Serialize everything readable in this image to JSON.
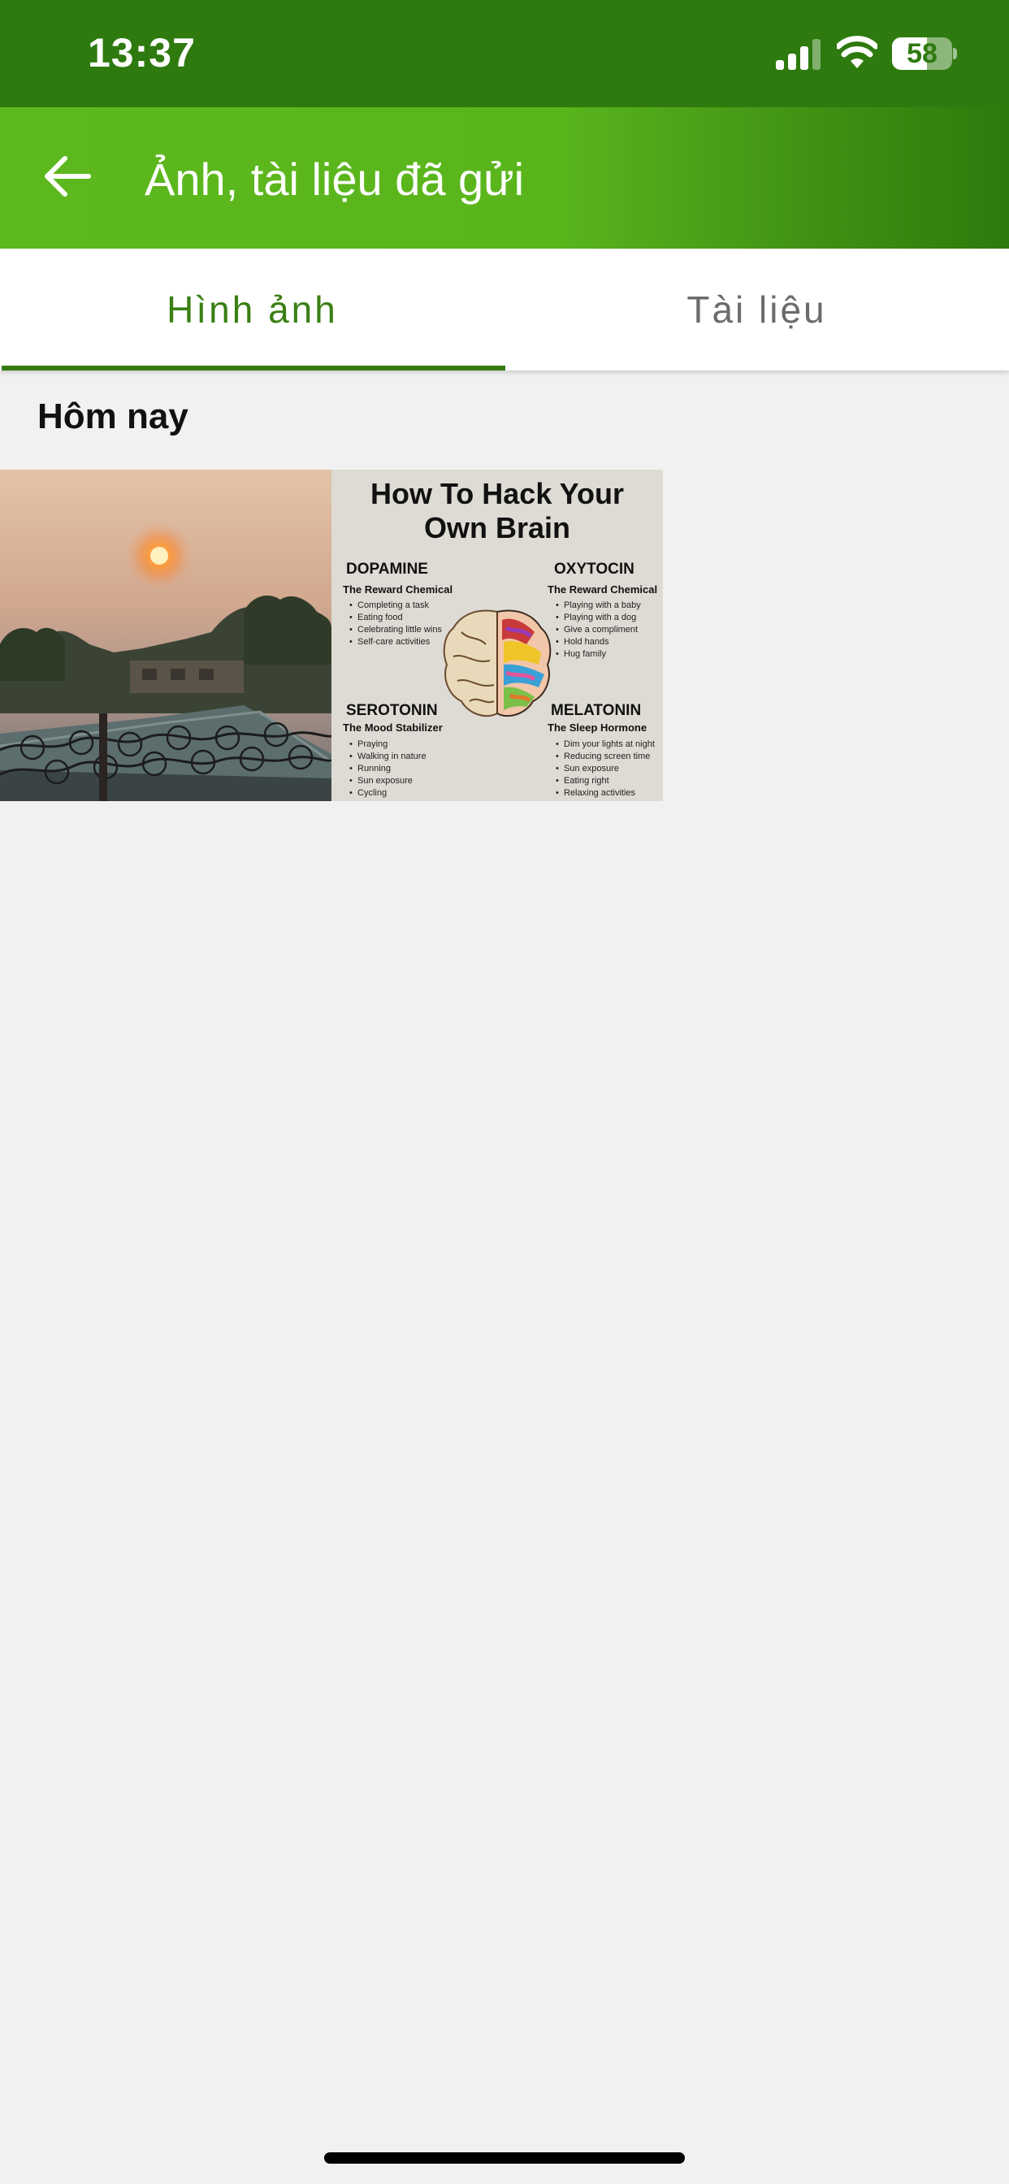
{
  "status_bar": {
    "time": "13:37",
    "battery_percent": "58",
    "battery_level": 0.58,
    "icons": [
      "signal-icon",
      "wifi-icon",
      "battery-icon"
    ]
  },
  "header": {
    "title": "Ảnh, tài liệu đã gửi",
    "back_icon": "arrow-left-icon",
    "gradient_colors": [
      "#5db81e",
      "#2d7a0c"
    ]
  },
  "tabs": [
    {
      "label": "Hình ảnh",
      "active": true
    },
    {
      "label": "Tài liệu",
      "active": false
    }
  ],
  "accent_color": "#357b12",
  "section": {
    "title": "Hôm nay"
  },
  "thumbnails": [
    {
      "name": "sunset-photo"
    },
    {
      "name": "brain-infographic",
      "title_line1": "How To Hack Your",
      "title_line2": "Own Brain",
      "quadrants": [
        {
          "heading": "DOPAMINE",
          "subheading": "The Reward Chemical",
          "items": [
            "Completing a task",
            "Eating food",
            "Celebrating little wins",
            "Self-care activities"
          ]
        },
        {
          "heading": "OXYTOCIN",
          "subheading": "The Reward Chemical",
          "items": [
            "Playing with a baby",
            "Playing with a dog",
            "Give a compliment",
            "Hold hands",
            "Hug family"
          ]
        },
        {
          "heading": "SEROTONIN",
          "subheading": "The Mood Stabilizer",
          "items": [
            "Praying",
            "Walking in nature",
            "Running",
            "Sun exposure",
            "Cycling"
          ]
        },
        {
          "heading": "MELATONIN",
          "subheading": "The Sleep Hormone",
          "items": [
            "Dim your lights at night",
            "Reducing screen time",
            "Sun exposure",
            "Eating right",
            "Relaxing activities"
          ]
        }
      ]
    }
  ]
}
